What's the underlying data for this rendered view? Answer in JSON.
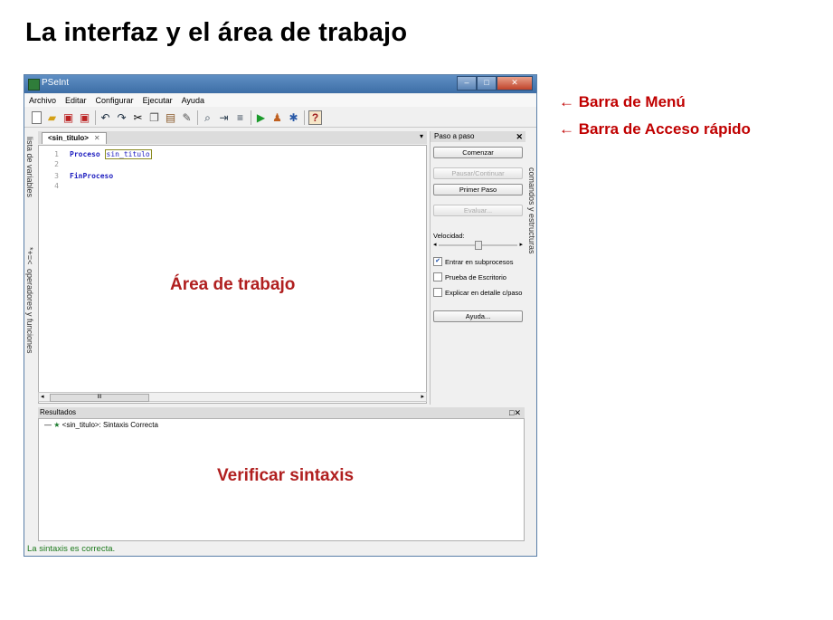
{
  "slide": {
    "title": "La interfaz y el área de trabajo",
    "annotations": [
      "← Barra de Menú",
      "← Barra de Acceso rápido"
    ],
    "label_work_area": "Área de trabajo",
    "label_verify": "Verificar sintaxis",
    "accent_color": "#c00000"
  },
  "window": {
    "title": "PSeInt",
    "controls": [
      "–",
      "□",
      "✕"
    ]
  },
  "menu": [
    "Archivo",
    "Editar",
    "Configurar",
    "Ejecutar",
    "Ayuda"
  ],
  "toolbar": {
    "icons": [
      "new-file-icon",
      "open-folder-icon",
      "save-icon",
      "save-as-icon",
      "undo-icon",
      "redo-icon",
      "cut-icon",
      "copy-icon",
      "paste-icon",
      "edit-icon",
      "search-icon",
      "indent-icon",
      "comment-icon",
      "run-icon",
      "step-icon",
      "debug-icon",
      "help-icon"
    ]
  },
  "left_tabs": {
    "variables": "lista de variables",
    "operators": "operadores y funciones",
    "operator_symbols": "*+=<"
  },
  "editor": {
    "tab_label": "<sin_titulo>",
    "tab_close": "✕",
    "tabs_menu": "▾",
    "lines": [
      {
        "n": "1",
        "kw": "Proceso",
        "name": "sin_titulo"
      },
      {
        "n": "2",
        "kw": "",
        "name": ""
      },
      {
        "n": "3",
        "kw": "FinProceso",
        "name": ""
      },
      {
        "n": "4",
        "kw": "",
        "name": ""
      }
    ],
    "scroll_thumb": "III"
  },
  "step_panel": {
    "header": "Paso a paso",
    "close": "✕",
    "start": "Comenzar",
    "pause": "Pausar/Continuar",
    "first_step": "Primer Paso",
    "evaluate": "Evaluar...",
    "speed_label": "Velocidad:",
    "speed_level": 0.5,
    "enter_subprocesses": "Entrar en subprocesos",
    "enter_subprocesses_checked": true,
    "desk_test": "Prueba de Escritorio",
    "desk_test_checked": false,
    "explain_detail": "Explicar en detalle c/paso",
    "explain_detail_checked": false,
    "help": "Ayuda..."
  },
  "right_tab": "comandos y estructuras",
  "results": {
    "header": "Resultados",
    "controls": "□✕",
    "item": "<sin_titulo>: Sintaxis Correcta"
  },
  "status": "La sintaxis es correcta."
}
